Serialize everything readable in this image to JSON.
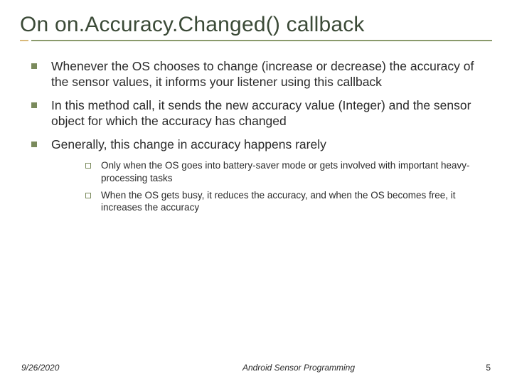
{
  "title": "On on.Accuracy.Changed() callback",
  "bullets": [
    "Whenever the OS chooses to change (increase or decrease) the accuracy of the sensor values, it informs your listener using this callback",
    "In this method call, it sends the new accuracy value (Integer) and the sensor object for which the accuracy has changed",
    "Generally, this change in accuracy happens rarely"
  ],
  "sub_bullets": [
    "Only when the OS goes into battery-saver mode or gets involved with important heavy-processing tasks",
    "When the OS gets busy, it reduces the accuracy, and when the OS becomes free, it increases the accuracy"
  ],
  "footer": {
    "date": "9/26/2020",
    "title": "Android Sensor Programming",
    "page": "5"
  }
}
